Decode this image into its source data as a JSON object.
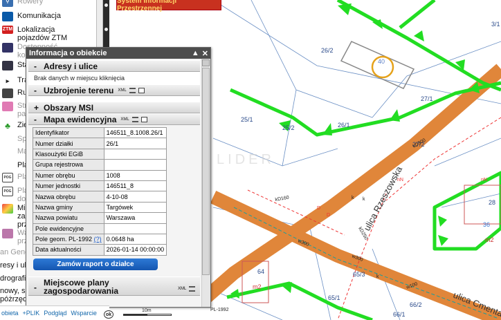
{
  "sidebar": {
    "items": [
      {
        "label": "Rowery",
        "icon": "bike-icon",
        "color": "#3a6fb0"
      },
      {
        "label": "Komunikacja",
        "icon": "bus-icon",
        "color": "#0a5aa8"
      },
      {
        "label": "Lokalizacja pojazdów ZTM",
        "icon": "ztm-icon",
        "color": "#d32020"
      },
      {
        "label": "Dostępność komunikacji publ.",
        "icon": "bus-stop-icon",
        "color": "#336"
      },
      {
        "label": "Sta",
        "icon": "station-icon",
        "color": "#334"
      },
      {
        "label": "Transpo",
        "icon": "arrow-icon",
        "color": "#222"
      },
      {
        "label": "Ruc",
        "icon": "car-icon",
        "color": "#444"
      },
      {
        "label": "Stre par",
        "icon": "zone-icon",
        "color": "#e07bb4"
      },
      {
        "label": "Zieleń",
        "icon": "tree-icon",
        "color": "#2a9a2a"
      },
      {
        "label": "Sport i r",
        "icon": "sport-icon",
        "color": "#888"
      },
      {
        "label": "Mapy ha",
        "icon": "noise-icon",
        "color": "#888"
      },
      {
        "label": "Planowa",
        "icon": "planning-icon",
        "color": "#777"
      },
      {
        "label": "Plan",
        "icon": "poq-icon",
        "color": "#444"
      },
      {
        "label": "Plan doc",
        "icon": "poq-icon-2",
        "color": "#444"
      },
      {
        "label": "Mie zag prz",
        "icon": "mpzp-icon",
        "color": "#c33"
      },
      {
        "label": "Wa prz",
        "icon": "wz-icon",
        "color": "#b7a"
      },
      {
        "label": "an Genera",
        "icon": "",
        "color": "#555"
      },
      {
        "label": "resy i ulic",
        "icon": "",
        "color": "#555"
      },
      {
        "label": "drografia",
        "icon": "",
        "color": "#555"
      },
      {
        "label": "nowy, siat póżrzędny",
        "icon": "",
        "color": "#555"
      }
    ]
  },
  "bottom_links": [
    "obieta",
    "+PLIK",
    "Podgląd",
    "Wsparcie"
  ],
  "header_tab": "System Informacji Przestrzennej",
  "panel": {
    "title": "Informacja o obiekcie",
    "sections": {
      "adresy": {
        "sign": "-",
        "label": "Adresy i ulice",
        "note": "Brak danych w miejscu kliknięcia"
      },
      "uzbrojenie": {
        "sign": "-",
        "label": "Uzbrojenie terenu",
        "badge": "XML"
      },
      "msi": {
        "sign": "+",
        "label": "Obszary MSI"
      },
      "mapa": {
        "sign": "-",
        "label": "Mapa ewidencyjna",
        "badge": "XML"
      },
      "mpzp": {
        "sign": "-",
        "label": "Miejscowe plany zagospodarowania przestrzennego",
        "badge": "XML"
      }
    },
    "table": [
      {
        "key": "Identyfikator",
        "value": "146511_8.1008.26/1"
      },
      {
        "key": "Numer działki",
        "value": "26/1"
      },
      {
        "key": "Klasoużytki EGiB",
        "value": ""
      },
      {
        "key": "Grupa rejestrowa",
        "value": ""
      },
      {
        "key": "Numer obrębu",
        "value": "1008"
      },
      {
        "key": "Numer jednostki",
        "value": "146511_8"
      },
      {
        "key": "Nazwa obrębu",
        "value": "4-10-08"
      },
      {
        "key": "Nazwa gminy",
        "value": "Targówek"
      },
      {
        "key": "Nazwa powiatu",
        "value": "Warszawa"
      },
      {
        "key": "Pole ewidencyjne",
        "value": ""
      },
      {
        "key": "Pole geom. PL-1992",
        "value": "0.0648 ha",
        "link": "(?)"
      },
      {
        "key": "Data aktualności",
        "value": "2026-01-14 00:00:00"
      }
    ],
    "order_button": "Zamów raport o działce"
  },
  "map": {
    "parcels": [
      "3/1",
      "26/2",
      "27/1",
      "25/1",
      "25/2",
      "26/1",
      "27/2",
      "28",
      "36",
      "64",
      "m2",
      "m2",
      "65/3",
      "65/1",
      "66/2",
      "66/1"
    ],
    "streets": [
      "ulica Rzeszowska",
      "ulica Cmentarna"
    ],
    "selected_number": "40",
    "utility_labels": [
      "kD160",
      "D",
      "D",
      "w300",
      "w300",
      "w100",
      "kD250",
      "kD300",
      "nN",
      "nN",
      "k",
      "k",
      "k"
    ],
    "watermark": "LIDER",
    "scale_label": "10m",
    "crs_label": "PL-1992",
    "ok_label": "ok",
    "colors": {
      "green": "#22dd22",
      "road": "#e0863a",
      "parcel": "#c55"
    }
  }
}
